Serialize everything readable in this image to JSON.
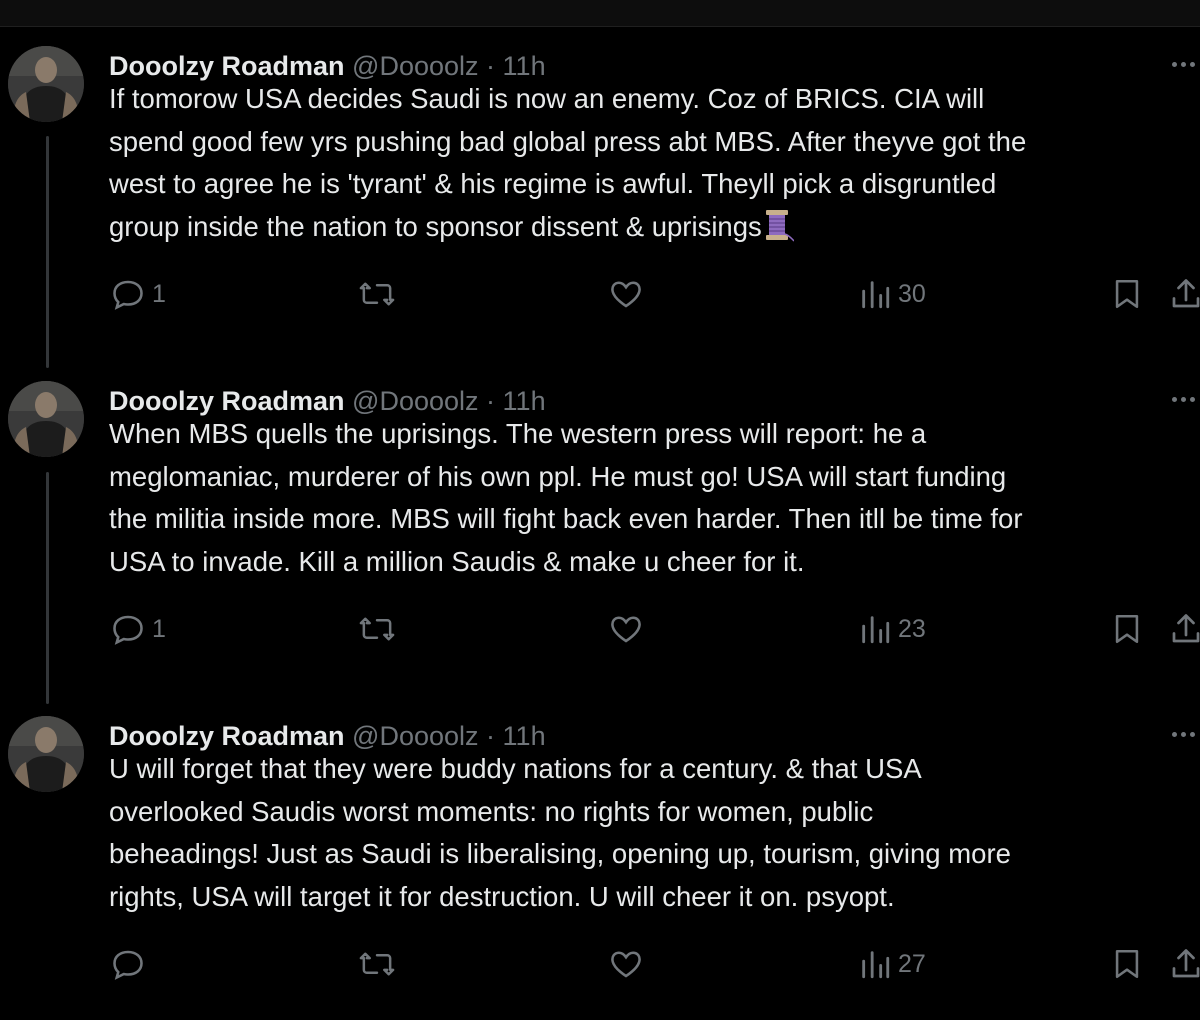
{
  "colors": {
    "background": "#000000",
    "text": "#e7e9ea",
    "muted": "#71767b",
    "thread_line": "#333639"
  },
  "tweets": [
    {
      "name": "Dooolzy Roadman",
      "handle": "@Doooolz",
      "separator": "·",
      "time": "11h",
      "text": "If tomorow USA decides Saudi is now an enemy. Coz of BRICS. CIA will\nspend good few yrs pushing bad global press abt MBS. After theyve got the\nwest to agree he is 'tyrant' & his regime is awful. Theyll pick a disgruntled\ngroup inside the nation to sponsor dissent & uprisings",
      "emoji": "thread-spool-icon",
      "replies": "1",
      "retweets": "",
      "likes": "",
      "views": "30"
    },
    {
      "name": "Dooolzy Roadman",
      "handle": "@Doooolz",
      "separator": "·",
      "time": "11h",
      "text": "When MBS quells the uprisings. The western press will report: he a\nmeglomaniac, murderer of his own ppl. He must go! USA will start funding\nthe militia inside more. MBS will fight back even harder. Then itll be time for\nUSA to invade. Kill a million Saudis & make u cheer for it.",
      "replies": "1",
      "retweets": "",
      "likes": "",
      "views": "23"
    },
    {
      "name": "Dooolzy Roadman",
      "handle": "@Doooolz",
      "separator": "·",
      "time": "11h",
      "text": "U will forget that they were buddy nations for a century. & that USA\noverlooked Saudis worst moments: no rights for women, public\nbeheadings! Just as Saudi is liberalising, opening up, tourism, giving more\nrights, USA will target it for destruction. U will cheer it on. psyopt.",
      "replies": "",
      "retweets": "",
      "likes": "",
      "views": "27"
    }
  ]
}
